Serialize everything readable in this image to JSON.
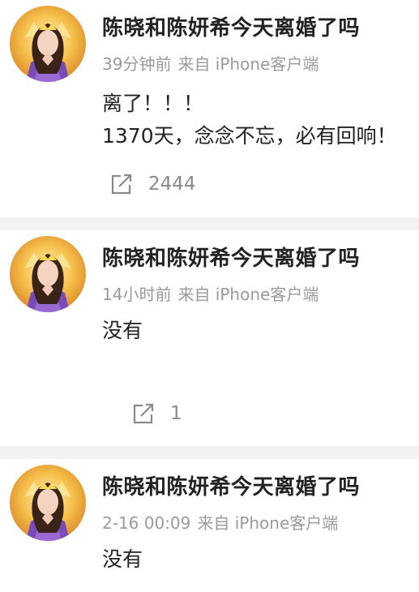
{
  "posts": [
    {
      "username": "陈晓和陈妍希今天离婚了吗",
      "time": "39分钟前",
      "source": "来自 iPhone客户端",
      "lines": [
        "离了！！！",
        "1370天，念念不忘，必有回响！"
      ],
      "repost_count": "2444"
    },
    {
      "username": "陈晓和陈妍希今天离婚了吗",
      "time": "14小时前",
      "source": "来自 iPhone客户端",
      "lines": [
        "没有"
      ],
      "repost_count": "1"
    },
    {
      "username": "陈晓和陈妍希今天离婚了吗",
      "time": "2-16 00:09",
      "source": "来自 iPhone客户端",
      "lines": [
        "没有"
      ]
    }
  ],
  "icons": {
    "repost": "share-icon"
  },
  "colors": {
    "text_primary": "#222222",
    "text_secondary": "#9a9a9a",
    "divider": "#f2f2f2"
  }
}
